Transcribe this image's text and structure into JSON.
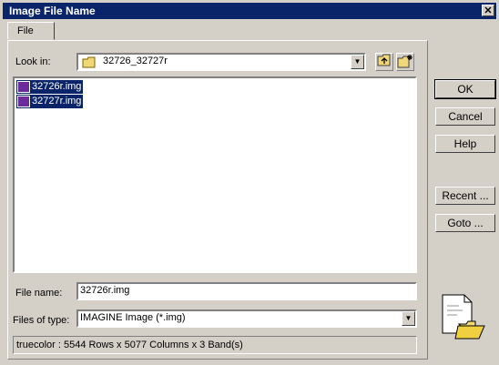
{
  "window": {
    "title": "Image File Name",
    "close_label": "✕"
  },
  "tabs": [
    {
      "label": "File"
    }
  ],
  "look_in": {
    "label": "Look in:",
    "value": "32726_32727r"
  },
  "files": [
    {
      "name": "32726r.img",
      "selected": true
    },
    {
      "name": "32727r.img",
      "selected": true
    }
  ],
  "file_name": {
    "label": "File name:",
    "value": "32726r.img"
  },
  "file_type": {
    "label": "Files of type:",
    "value": "IMAGINE Image (*.img)"
  },
  "status": {
    "text": "truecolor : 5544 Rows x 5077 Columns x 3 Band(s)"
  },
  "buttons": {
    "ok": "OK",
    "cancel": "Cancel",
    "help": "Help",
    "recent": "Recent ...",
    "goto": "Goto ..."
  },
  "colors": {
    "title_bar": "#0a246a",
    "selection": "#0a246a",
    "face": "#d4d0c8"
  }
}
